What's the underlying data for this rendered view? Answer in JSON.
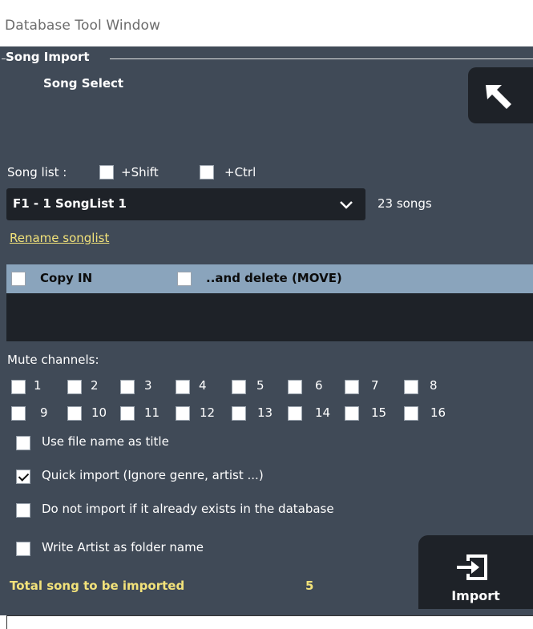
{
  "window": {
    "title": "Database Tool Window"
  },
  "group": {
    "label": "Song Import",
    "subtitle": "Song Select"
  },
  "songlist": {
    "label": "Song list :",
    "shift_label": "+Shift",
    "ctrl_label": "+Ctrl",
    "shift_checked": false,
    "ctrl_checked": false,
    "selected": "F1 - 1 SongList 1",
    "count_text": "23 songs",
    "rename_link": "Rename songlist"
  },
  "copy": {
    "copy_in_label": "Copy IN",
    "copy_in_checked": false,
    "move_label": "..and delete (MOVE)",
    "move_checked": false
  },
  "mute": {
    "label": "Mute channels:",
    "row1": [
      "1",
      "2",
      "3",
      "4",
      "5",
      "6",
      "7",
      "8"
    ],
    "row2": [
      "9",
      "10",
      "11",
      "12",
      "13",
      "14",
      "15",
      "16"
    ]
  },
  "options": {
    "use_filename": {
      "label": "Use file name as title",
      "checked": false
    },
    "quick_import": {
      "label": "Quick import (Ignore genre, artist ...)",
      "checked": true
    },
    "skip_existing": {
      "label": "Do not import if it already exists in the database",
      "checked": false
    },
    "artist_folder": {
      "label": "Write Artist as folder name",
      "checked": false
    }
  },
  "total": {
    "label": "Total song to be imported",
    "value": "5"
  },
  "import_button": {
    "label": "Import"
  },
  "icons": {
    "back": "back-arrow-icon",
    "import": "import-icon",
    "dropdown": "chevron-down-icon"
  },
  "colors": {
    "panel": "#404a57",
    "dark": "#1e2228",
    "highlight_bar": "#8aa4bc",
    "accent_yellow": "#f2e27a"
  }
}
